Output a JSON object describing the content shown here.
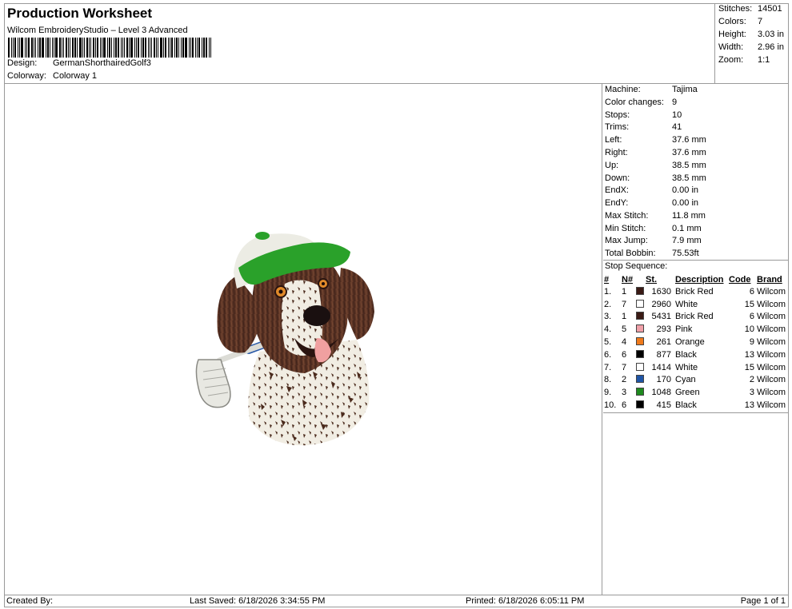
{
  "header": {
    "title": "Production Worksheet",
    "subtitle": "Wilcom EmbroideryStudio – Level 3 Advanced",
    "design_label": "Design:",
    "design_value": "GermanShorthairedGolf3",
    "colorway_label": "Colorway:",
    "colorway_value": "Colorway 1"
  },
  "summary": {
    "stitches_label": "Stitches:",
    "stitches": "14501",
    "colors_label": "Colors:",
    "colors": "7",
    "height_label": "Height:",
    "height": "3.03 in",
    "width_label": "Width:",
    "width": "2.96 in",
    "zoom_label": "Zoom:",
    "zoom": "1:1"
  },
  "machine": {
    "machine_label": "Machine:",
    "machine": "Tajima",
    "color_changes_label": "Color changes:",
    "color_changes": "9",
    "stops_label": "Stops:",
    "stops": "10",
    "trims_label": "Trims:",
    "trims": "41",
    "left_label": "Left:",
    "left": "37.6 mm",
    "right_label": "Right:",
    "right": "37.6 mm",
    "up_label": "Up:",
    "up": "38.5 mm",
    "down_label": "Down:",
    "down": "38.5 mm",
    "endx_label": "EndX:",
    "endx": "0.00 in",
    "endy_label": "EndY:",
    "endy": "0.00 in",
    "max_stitch_label": "Max Stitch:",
    "max_stitch": "11.8 mm",
    "min_stitch_label": "Min Stitch:",
    "min_stitch": "0.1 mm",
    "max_jump_label": "Max Jump:",
    "max_jump": "7.9 mm",
    "total_bobbin_label": "Total Bobbin:",
    "total_bobbin": "75.53ft"
  },
  "stop_sequence": {
    "title": "Stop Sequence:",
    "headers": {
      "idx": "#",
      "n": "N#",
      "st": "St.",
      "desc": "Description",
      "code": "Code",
      "brand": "Brand"
    },
    "rows": [
      {
        "idx": "1.",
        "n": "1",
        "color": "#3a1a14",
        "st": "1630",
        "desc": "Brick Red",
        "code": "6",
        "brand": "Wilcom"
      },
      {
        "idx": "2.",
        "n": "7",
        "color": "#ffffff",
        "st": "2960",
        "desc": "White",
        "code": "15",
        "brand": "Wilcom"
      },
      {
        "idx": "3.",
        "n": "1",
        "color": "#3a1a14",
        "st": "5431",
        "desc": "Brick Red",
        "code": "6",
        "brand": "Wilcom"
      },
      {
        "idx": "4.",
        "n": "5",
        "color": "#f0a0a8",
        "st": "293",
        "desc": "Pink",
        "code": "10",
        "brand": "Wilcom"
      },
      {
        "idx": "5.",
        "n": "4",
        "color": "#f07a1a",
        "st": "261",
        "desc": "Orange",
        "code": "9",
        "brand": "Wilcom"
      },
      {
        "idx": "6.",
        "n": "6",
        "color": "#000000",
        "st": "877",
        "desc": "Black",
        "code": "13",
        "brand": "Wilcom"
      },
      {
        "idx": "7.",
        "n": "7",
        "color": "#ffffff",
        "st": "1414",
        "desc": "White",
        "code": "15",
        "brand": "Wilcom"
      },
      {
        "idx": "8.",
        "n": "2",
        "color": "#1f55a6",
        "st": "170",
        "desc": "Cyan",
        "code": "2",
        "brand": "Wilcom"
      },
      {
        "idx": "9.",
        "n": "3",
        "color": "#1e8a1e",
        "st": "1048",
        "desc": "Green",
        "code": "3",
        "brand": "Wilcom"
      },
      {
        "idx": "10.",
        "n": "6",
        "color": "#000000",
        "st": "415",
        "desc": "Black",
        "code": "13",
        "brand": "Wilcom"
      }
    ]
  },
  "footer": {
    "created_by": "Created By:",
    "last_saved": "Last Saved: 6/18/2026 3:34:55 PM",
    "printed": "Printed: 6/18/2026 6:05:11 PM",
    "page": "Page 1 of 1"
  }
}
